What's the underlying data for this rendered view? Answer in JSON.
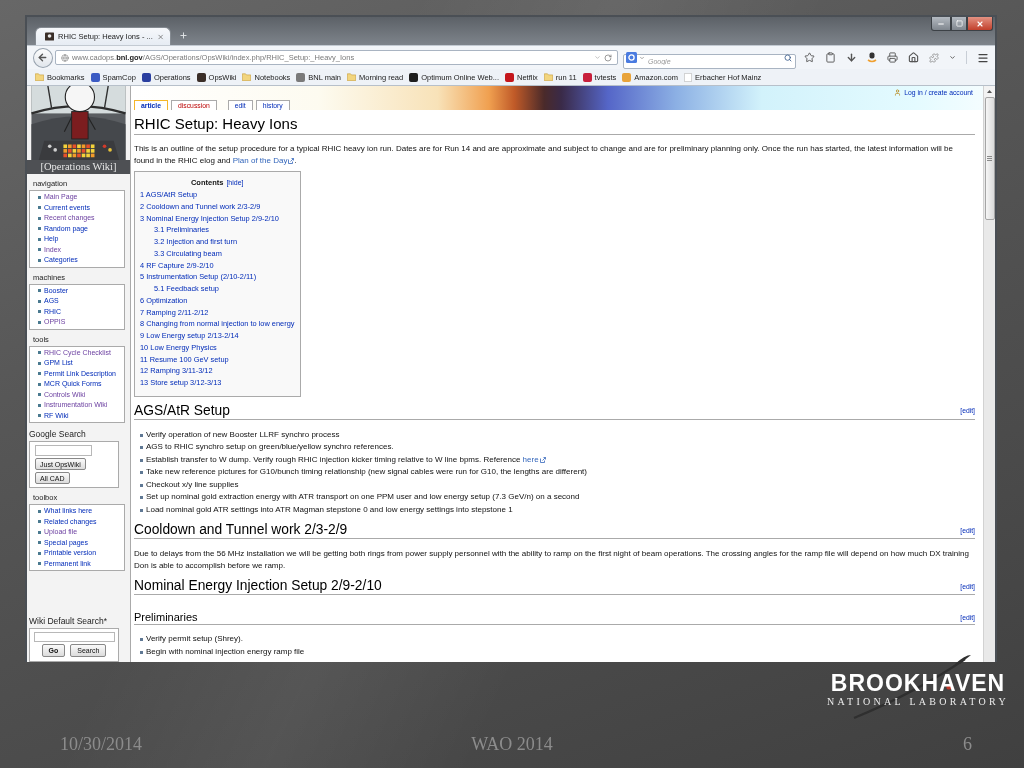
{
  "browser": {
    "tabs": [
      {
        "title": "RHIC Setup: Heavy Ions - ...",
        "selected": true
      }
    ],
    "url": "www.cadops.**bnl.gov**/AGS/Operations/OpsWiki/index.php/RHIC_Setup:_Heavy_Ions",
    "search": {
      "placeholder": "Google"
    },
    "bookmarks": [
      {
        "label": "Bookmarks",
        "kind": "folder"
      },
      {
        "label": "SpamCop",
        "kind": "site",
        "color": "#3b5bc4"
      },
      {
        "label": "Operations",
        "kind": "site",
        "color": "#2a3fa0"
      },
      {
        "label": "OpsWiki",
        "kind": "site",
        "color": "#3a2e28"
      },
      {
        "label": "Notebooks",
        "kind": "folder"
      },
      {
        "label": "BNL main",
        "kind": "site",
        "color": "#7a7a7a"
      },
      {
        "label": "Morning read",
        "kind": "folder"
      },
      {
        "label": "Optimum Online Web...",
        "kind": "site",
        "color": "#1e1e1e"
      },
      {
        "label": "Netflix",
        "kind": "site",
        "color": "#c4161c"
      },
      {
        "label": "run 11",
        "kind": "folder"
      },
      {
        "label": "tvtests",
        "kind": "site",
        "color": "#c8203c"
      },
      {
        "label": "Amazon.com",
        "kind": "site",
        "color": "#e8a33a"
      },
      {
        "label": "Erbacher Hof Mainz",
        "kind": "page"
      }
    ]
  },
  "wiki": {
    "logo": {
      "caption": "[Operations Wiki]"
    },
    "portlets": [
      {
        "kind": "links",
        "title": "navigation",
        "items": [
          {
            "label": "Main Page",
            "visited": true
          },
          {
            "label": "Current events",
            "visited": false
          },
          {
            "label": "Recent changes",
            "visited": true
          },
          {
            "label": "Random page",
            "visited": false
          },
          {
            "label": "Help",
            "visited": false
          },
          {
            "label": "Index",
            "visited": true
          },
          {
            "label": "Categories",
            "visited": false
          }
        ]
      },
      {
        "kind": "links",
        "title": "machines",
        "items": [
          {
            "label": "Booster",
            "visited": false
          },
          {
            "label": "AGS",
            "visited": false
          },
          {
            "label": "RHIC",
            "visited": false
          },
          {
            "label": "OPPIS",
            "visited": true
          }
        ]
      },
      {
        "kind": "links",
        "title": "tools",
        "items": [
          {
            "label": "RHIC Cycle Checklist",
            "visited": true
          },
          {
            "label": "GPM List",
            "visited": false
          },
          {
            "label": "Permit Link Description",
            "visited": false
          },
          {
            "label": "MCR Quick Forms",
            "visited": false
          },
          {
            "label": "Controls Wiki",
            "visited": true
          },
          {
            "label": "Instrumentation Wiki",
            "visited": true
          },
          {
            "label": "RF Wiki",
            "visited": false
          }
        ]
      },
      {
        "kind": "websearch",
        "title": "Google Search",
        "buttons": [
          {
            "label": "Just OpsWiki",
            "default": false
          },
          {
            "label": "All CAD",
            "default": false
          }
        ]
      },
      {
        "kind": "links",
        "title": "toolbox",
        "items": [
          {
            "label": "What links here",
            "visited": false
          },
          {
            "label": "Related changes",
            "visited": false
          },
          {
            "label": "Upload file",
            "visited": true
          },
          {
            "label": "Special pages",
            "visited": false
          },
          {
            "label": "Printable version",
            "visited": false
          },
          {
            "label": "Permanent link",
            "visited": false
          }
        ]
      },
      {
        "kind": "sitesearch",
        "title": "Wiki Default Search*",
        "buttons": [
          {
            "label": "Go",
            "default": true
          },
          {
            "label": "Search",
            "default": false
          }
        ]
      }
    ],
    "page_tabs": [
      {
        "label": "article",
        "selected": true,
        "missing": false
      },
      {
        "label": "discussion",
        "selected": false,
        "missing": true
      }
    ],
    "action_tabs": [
      {
        "label": "edit",
        "selected": false
      },
      {
        "label": "history",
        "selected": false
      }
    ],
    "user_link": "Log in / create account",
    "title": "RHIC Setup: Heavy Ions",
    "intro": {
      "text": "This is an outline of the setup procedure for a typical RHIC heavy ion run. Dates are for Run 14 and are approximate and subject to change and are for preliminary planning only. Once the run has started, the latest information will be found in the RHIC elog and ",
      "link": "Plan of the Day",
      "text_after": "."
    },
    "toc": {
      "title": "Contents",
      "toggle": "[hide]",
      "items": [
        {
          "label": "1 AGS/AtR Setup"
        },
        {
          "label": "2 Cooldown and Tunnel work 2/3-2/9"
        },
        {
          "label": "3 Nominal Energy Injection Setup 2/9-2/10",
          "children": [
            {
              "label": "3.1 Preliminaries"
            },
            {
              "label": "3.2 Injection and first turn"
            },
            {
              "label": "3.3 Circulating beam"
            }
          ]
        },
        {
          "label": "4 RF Capture 2/9-2/10"
        },
        {
          "label": "5 Instrumentation Setup (2/10-2/11)",
          "children": [
            {
              "label": "5.1 Feedback setup"
            }
          ]
        },
        {
          "label": "6 Optimization"
        },
        {
          "label": "7 Ramping 2/11-2/12"
        },
        {
          "label": "8 Changing from normal injection to low energy"
        },
        {
          "label": "9 Low Energy setup 2/13-2/14"
        },
        {
          "label": "10 Low Energy Physics"
        },
        {
          "label": "11 Resume 100 GeV setup"
        },
        {
          "label": "12 Ramping 3/11-3/12"
        },
        {
          "label": "13 Store setup 3/12-3/13"
        }
      ]
    },
    "sections": [
      {
        "kind": "section",
        "heading": "AGS/AtR Setup",
        "edit": "[edit]",
        "bullets": [
          {
            "text": "Verify operation of new Booster LLRF synchro process"
          },
          {
            "text": "AGS to RHIC synchro setup on green/blue/yellow synchro references."
          },
          {
            "text": "Establish transfer to W dump. Verify rough RHIC injection kicker timing relative to W line bpms. Reference ",
            "link": "here"
          },
          {
            "text": "Take new reference pictures for G10/bunch timing relationship (new signal cables were run for G10, the lengths are different)"
          },
          {
            "text": "Checkout x/y line supplies"
          },
          {
            "text": "Set up nominal gold extraction energy with ATR transport on one PPM user and low energy setup (7.3 GeV/n) on a second"
          },
          {
            "text": "Load nominal gold ATR settings into ATR Magman stepstone 0 and low energy settings into stepstone 1"
          }
        ]
      },
      {
        "kind": "section",
        "heading": "Cooldown and Tunnel work 2/3-2/9",
        "edit": "[edit]",
        "paragraph": "Due to delays from the 56 MHz installation we will be getting both rings from power supply personnel with the ability to ramp on the first night of beam operations. The crossing angles for the ramp file will depend on how much DX training Don is able to accomplish before we ramp."
      },
      {
        "kind": "section",
        "heading": "Nominal Energy Injection Setup 2/9-2/10",
        "edit": "[edit]"
      },
      {
        "kind": "subsection",
        "heading": "Preliminaries",
        "edit": "[edit]",
        "bullets": [
          {
            "text": "Verify permit setup (Shrey)."
          },
          {
            "text": "Begin with nominal injection energy ramp file"
          }
        ]
      }
    ]
  },
  "slide": {
    "logo": {
      "name": "BROOKHAVEN",
      "subtitle": "NATIONAL LABORATORY"
    },
    "footer": {
      "date": "10/30/2014",
      "event": "WAO 2014",
      "page": "6"
    }
  }
}
